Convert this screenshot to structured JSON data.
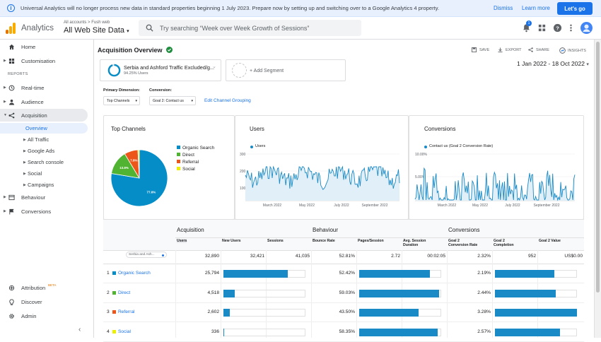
{
  "banner": {
    "message": "Universal Analytics will no longer process new data in standard properties beginning 1 July 2023. Prepare now by setting up and switching over to a Google Analytics 4 property.",
    "dismiss": "Dismiss",
    "learn_more": "Learn more",
    "cta": "Let's go"
  },
  "header": {
    "app_name": "Analytics",
    "breadcrumb": "All accounts > Fush web",
    "property": "All Web Site Data",
    "search_placeholder": "Try searching “Week over Week Growth of Sessions”",
    "notification_count": "1"
  },
  "sidebar": {
    "home": "Home",
    "customisation": "Customisation",
    "reports_heading": "REPORTS",
    "realtime": "Real-time",
    "audience": "Audience",
    "acquisition": "Acquisition",
    "sub": {
      "overview": "Overview",
      "all_traffic": "All Traffic",
      "google_ads": "Google Ads",
      "search_console": "Search console",
      "social": "Social",
      "campaigns": "Campaigns"
    },
    "behaviour": "Behaviour",
    "conversions": "Conversions",
    "attribution": "Attribution",
    "beta": "BETA",
    "discover": "Discover",
    "admin": "Admin"
  },
  "page": {
    "title": "Acquisition Overview",
    "save": "SAVE",
    "export": "EXPORT",
    "share": "SHARE",
    "insights": "INSIGHTS",
    "date_range": "1 Jan 2022 - 18 Oct 2022"
  },
  "segment": {
    "name": "Serbia and Ashford Traffic Excluded/g...",
    "sub": "94.25% Users",
    "add": "+ Add Segment"
  },
  "controls": {
    "primary_label": "Primary Dimension:",
    "primary_value": "Top Channels",
    "conversion_label": "Conversion:",
    "conversion_value": "Goal 2: Contact us",
    "edit": "Edit Channel Grouping"
  },
  "cards": {
    "top": "Top Channels",
    "users": "Users",
    "conversions": "Conversions",
    "users_legend": "Users",
    "conv_legend": "Contact us (Goal 2 Conversion Rate)"
  },
  "pie": {
    "slices": [
      {
        "label": "Organic Search",
        "value": 77.6,
        "color": "#058dc7"
      },
      {
        "label": "Direct",
        "value": 13.8,
        "color": "#50b432"
      },
      {
        "label": "Referral",
        "value": 7.8,
        "color": "#ed561b"
      },
      {
        "label": "Social",
        "value": 0.8,
        "color": "#edef00"
      }
    ],
    "labels": [
      "77.6%",
      "13.8%",
      "7.8%"
    ]
  },
  "users_chart": {
    "ticks": [
      "300",
      "200",
      "100"
    ],
    "xlabels": [
      "March 2022",
      "May 2022",
      "July 2022",
      "September 2022"
    ]
  },
  "conv_chart": {
    "ticks": [
      "10.00%",
      "5.00%"
    ],
    "xlabels": [
      "March 2022",
      "May 2022",
      "July 2022",
      "September 2022"
    ]
  },
  "table": {
    "groups": {
      "acq": "Acquisition",
      "beh": "Behaviour",
      "conv": "Conversions"
    },
    "cols": {
      "users": "Users",
      "new_users": "New Users",
      "sessions": "Sessions",
      "bounce": "Bounce Rate",
      "pps": "Pages/Session",
      "asd1": "Avg. Session",
      "asd2": "Duration",
      "cr1": "Goal 2",
      "cr2": "Conversion Rate",
      "gc1": "Goal 2",
      "gc2": "Completion",
      "gv": "Goal 2 Value"
    },
    "segment_chip": "Serbia and Ash...",
    "totals": {
      "users": "32,890",
      "new_users": "32,421",
      "sessions": "41,035",
      "bounce": "52.81%",
      "pps": "2.72",
      "asd": "00:02:05",
      "cr": "2.32%",
      "gc": "952",
      "gv": "US$0.00"
    },
    "rows": [
      {
        "n": "1",
        "name": "Organic Search",
        "color": "#058dc7",
        "users": "25,794",
        "bounce": "52.42%",
        "cr": "2.19%",
        "nu": 0.78,
        "bb": 0.86,
        "cb": 0.72
      },
      {
        "n": "2",
        "name": "Direct",
        "color": "#50b432",
        "users": "4,518",
        "bounce": "59.03%",
        "cr": "2.44%",
        "nu": 0.14,
        "bb": 0.97,
        "cb": 0.74
      },
      {
        "n": "3",
        "name": "Referral",
        "color": "#ed561b",
        "users": "2,602",
        "bounce": "43.50%",
        "cr": "3.28%",
        "nu": 0.08,
        "bb": 0.72,
        "cb": 1.0
      },
      {
        "n": "4",
        "name": "Social",
        "color": "#edef00",
        "users": "336",
        "bounce": "58.35%",
        "cr": "2.57%",
        "nu": 0.01,
        "bb": 0.96,
        "cb": 0.79
      }
    ]
  },
  "colors": {
    "accent": "#1a73e8",
    "bar": "#1a8ac6",
    "green": "#1e8e3e"
  }
}
